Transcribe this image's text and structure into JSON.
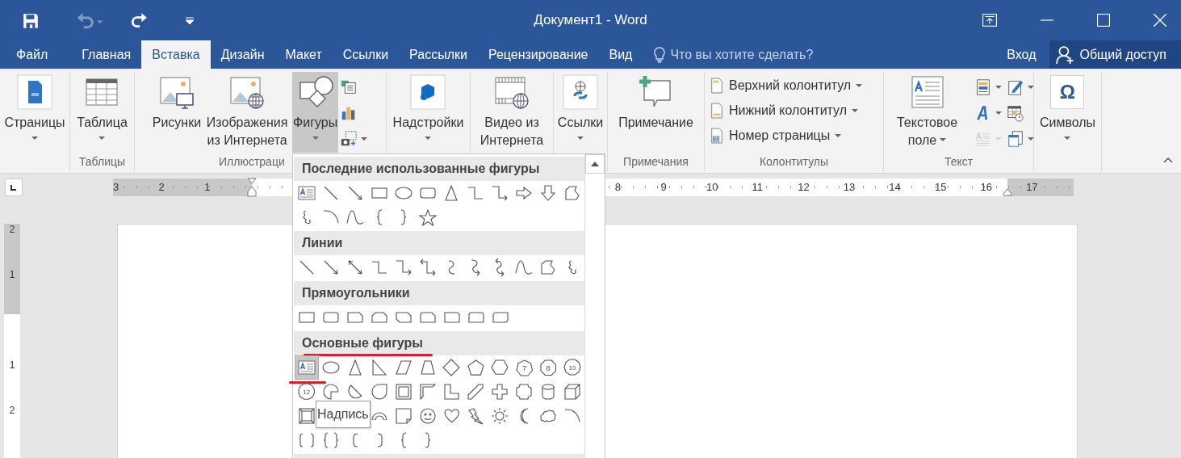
{
  "window": {
    "title": "Документ1 - Word"
  },
  "quick_access": [
    {
      "kind": "save",
      "disabled": false
    },
    {
      "kind": "undo",
      "disabled": true
    },
    {
      "kind": "redo",
      "disabled": false
    },
    {
      "kind": "customize",
      "disabled": false
    }
  ],
  "tabs": [
    {
      "label": "Файл",
      "selected": false
    },
    {
      "label": "Главная",
      "selected": false
    },
    {
      "label": "Вставка",
      "selected": true
    },
    {
      "label": "Дизайн",
      "selected": false
    },
    {
      "label": "Макет",
      "selected": false
    },
    {
      "label": "Ссылки",
      "selected": false
    },
    {
      "label": "Рассылки",
      "selected": false
    },
    {
      "label": "Рецензирование",
      "selected": false
    },
    {
      "label": "Вид",
      "selected": false
    }
  ],
  "tell_me": {
    "placeholder": "Что вы хотите сделать?"
  },
  "sign_in": "Вход",
  "share": "Общий доступ",
  "ribbon": {
    "groups": [
      {
        "buttons": [
          {
            "kind": "pages",
            "label": "Страницы",
            "dropdown": true,
            "pressed": false
          }
        ]
      },
      {
        "label": "Таблицы",
        "buttons": [
          {
            "kind": "table",
            "label": "Таблица",
            "dropdown": true,
            "pressed": false
          }
        ]
      },
      {
        "label": "Иллюстраци",
        "buttons": [
          {
            "kind": "pictures",
            "label": "Рисунки",
            "dropdown": false,
            "pressed": false
          },
          {
            "kind": "online-pictures",
            "label": "Изображения из Интернета",
            "dropdown": false,
            "pressed": false
          },
          {
            "kind": "shapes",
            "label": "Фигуры",
            "dropdown": true,
            "pressed": true
          }
        ],
        "small": [
          {
            "kind": "smartart",
            "dropdown": false
          },
          {
            "kind": "chart",
            "dropdown": false
          },
          {
            "kind": "screenshot",
            "dropdown": true
          }
        ]
      },
      {
        "buttons": [
          {
            "kind": "addins",
            "label": "Надстройки",
            "dropdown": true,
            "pressed": false
          }
        ]
      },
      {
        "buttons": [
          {
            "kind": "online-video",
            "label": "Видео из Интернета",
            "dropdown": false,
            "pressed": false
          }
        ]
      },
      {
        "buttons": [
          {
            "kind": "links",
            "label": "Ссылки",
            "dropdown": true,
            "pressed": false
          }
        ]
      },
      {
        "label": "Примечания",
        "buttons": [
          {
            "kind": "comment",
            "label": "Примечание",
            "dropdown": false,
            "pressed": false
          }
        ]
      },
      {
        "label": "Колонтитулы",
        "list": [
          {
            "kind": "header",
            "label": "Верхний колонтитул",
            "dropdown": true
          },
          {
            "kind": "footer",
            "label": "Нижний колонтитул",
            "dropdown": true
          },
          {
            "kind": "page-number",
            "label": "Номер страницы",
            "dropdown": true
          }
        ]
      },
      {
        "label": "Текст",
        "buttons": [
          {
            "kind": "textbox",
            "label": "Текстовое поле",
            "dropdown": true,
            "pressed": false
          }
        ],
        "small": [
          {
            "kind": "quick-parts",
            "dropdown": true,
            "disabled": false
          },
          {
            "kind": "wordart",
            "dropdown": true,
            "disabled": false
          },
          {
            "kind": "drop-cap",
            "dropdown": true,
            "disabled": true
          },
          {
            "kind": "signature",
            "dropdown": true,
            "disabled": false
          },
          {
            "kind": "date-time",
            "dropdown": false,
            "disabled": false
          },
          {
            "kind": "object",
            "dropdown": true,
            "disabled": false
          }
        ]
      },
      {
        "buttons": [
          {
            "kind": "symbols",
            "label": "Символы",
            "glyph": "Ω",
            "dropdown": true,
            "pressed": false
          }
        ]
      }
    ]
  },
  "ruler": {
    "left_numbers": [
      "3",
      "2",
      "1"
    ],
    "right_numbers": [
      "8",
      "9",
      "10",
      "11",
      "12",
      "13",
      "14",
      "15",
      "16",
      "17"
    ]
  },
  "vertical_ruler": {
    "above": [
      "2",
      "1"
    ],
    "below": [
      "1",
      "2"
    ]
  },
  "shapes_gallery": {
    "sections": [
      {
        "title": "Последние использованные фигуры",
        "underlined": false,
        "rows": [
          [
            {
              "kind": "textbox"
            },
            {
              "kind": "line"
            },
            {
              "kind": "arrow"
            },
            {
              "kind": "rectangle"
            },
            {
              "kind": "oval"
            },
            {
              "kind": "rounded-rectangle"
            },
            {
              "kind": "triangle"
            },
            {
              "kind": "elbow-connector"
            },
            {
              "kind": "elbow-arrow"
            },
            {
              "kind": "right-arrow"
            },
            {
              "kind": "down-arrow"
            },
            {
              "kind": "freeform"
            }
          ],
          [
            {
              "kind": "scribble"
            },
            {
              "kind": "arc"
            },
            {
              "kind": "curve"
            },
            {
              "kind": "left-brace"
            },
            {
              "kind": "right-brace"
            },
            {
              "kind": "star"
            }
          ]
        ]
      },
      {
        "title": "Линии",
        "underlined": false,
        "rows": [
          [
            {
              "kind": "line"
            },
            {
              "kind": "arrow"
            },
            {
              "kind": "double-arrow"
            },
            {
              "kind": "elbow-connector"
            },
            {
              "kind": "elbow-arrow"
            },
            {
              "kind": "elbow-double-arrow"
            },
            {
              "kind": "curved-connector"
            },
            {
              "kind": "curved-arrow"
            },
            {
              "kind": "curved-double-arrow"
            },
            {
              "kind": "curve"
            },
            {
              "kind": "freeform"
            },
            {
              "kind": "scribble"
            }
          ]
        ]
      },
      {
        "title": "Прямоугольники",
        "underlined": false,
        "rows": [
          [
            {
              "kind": "rectangle"
            },
            {
              "kind": "rounded-rectangle"
            },
            {
              "kind": "snip-corner-rectangle"
            },
            {
              "kind": "snip-same-side-rectangle"
            },
            {
              "kind": "snip-diagonal-rectangle"
            },
            {
              "kind": "snip-round-rectangle"
            },
            {
              "kind": "round-corner-rectangle"
            },
            {
              "kind": "round-same-side-rectangle"
            },
            {
              "kind": "round-diagonal-rectangle"
            }
          ]
        ]
      },
      {
        "title": "Основные фигуры",
        "underlined": true,
        "rows": [
          [
            {
              "kind": "textbox",
              "selected": true,
              "underlined": true
            },
            {
              "kind": "oval",
              "selected": false,
              "underlined": false
            },
            {
              "kind": "triangle",
              "selected": false,
              "underlined": false
            },
            {
              "kind": "right-triangle",
              "selected": false,
              "underlined": false
            },
            {
              "kind": "parallelogram",
              "selected": false,
              "underlined": false
            },
            {
              "kind": "trapezoid",
              "selected": false,
              "underlined": false
            },
            {
              "kind": "diamond",
              "selected": false,
              "underlined": false
            },
            {
              "kind": "pentagon",
              "selected": false,
              "underlined": false
            },
            {
              "kind": "hexagon",
              "selected": false,
              "underlined": false
            },
            {
              "kind": "heptagon",
              "text": "7",
              "selected": false,
              "underlined": false
            },
            {
              "kind": "octagon",
              "text": "8",
              "selected": false,
              "underlined": false
            },
            {
              "kind": "decagon",
              "text": "10",
              "selected": false,
              "underlined": false
            }
          ],
          [
            {
              "kind": "dodecagon",
              "text": "12"
            },
            {
              "kind": "pie"
            },
            {
              "kind": "chord"
            },
            {
              "kind": "teardrop"
            },
            {
              "kind": "frame"
            },
            {
              "kind": "half-frame"
            },
            {
              "kind": "l-shape"
            },
            {
              "kind": "diagonal-stripe"
            },
            {
              "kind": "cross"
            },
            {
              "kind": "plaque"
            },
            {
              "kind": "can"
            },
            {
              "kind": "cube"
            }
          ],
          [
            {
              "kind": "bevel"
            },
            {
              "kind": "tooltip",
              "text": "Надпись"
            },
            {
              "kind": "block-arc"
            },
            {
              "kind": "folded-corner"
            },
            {
              "kind": "smiley"
            },
            {
              "kind": "heart"
            },
            {
              "kind": "lightning"
            },
            {
              "kind": "sun"
            },
            {
              "kind": "moon"
            },
            {
              "kind": "cloud"
            },
            {
              "kind": "arc"
            }
          ],
          [
            {
              "kind": "bracket-pair"
            },
            {
              "kind": "brace-pair"
            },
            {
              "kind": "left-bracket"
            },
            {
              "kind": "right-bracket"
            },
            {
              "kind": "left-brace"
            },
            {
              "kind": "right-brace"
            }
          ]
        ]
      }
    ]
  }
}
